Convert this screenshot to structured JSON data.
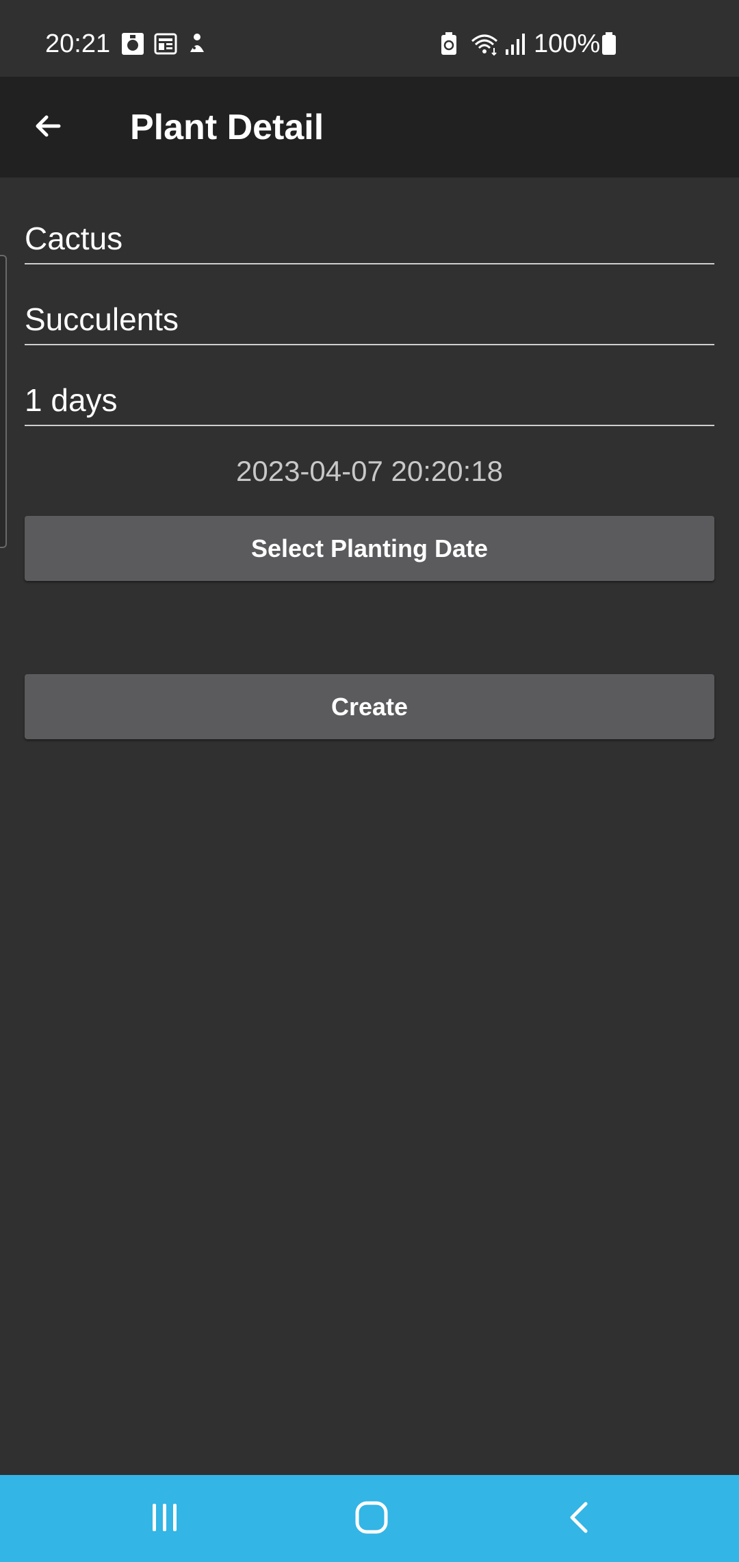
{
  "status_bar": {
    "time": "20:21",
    "battery_percent": "100%",
    "icons": [
      "gallery-icon",
      "news-icon",
      "game-icon",
      "battery-saver-icon",
      "wifi-icon",
      "signal-icon",
      "battery-icon"
    ]
  },
  "app_bar": {
    "title": "Plant Detail",
    "back_icon": "arrow-back-icon"
  },
  "form": {
    "name_value": "Cactus",
    "type_value": "Succulents",
    "interval_value": "1 days",
    "planting_date": "2023-04-07 20:20:18",
    "select_date_label": "Select Planting Date",
    "create_label": "Create"
  },
  "nav_bar": {
    "color": "#33b5e5",
    "buttons": [
      "recent-apps-icon",
      "home-icon",
      "back-icon"
    ]
  }
}
